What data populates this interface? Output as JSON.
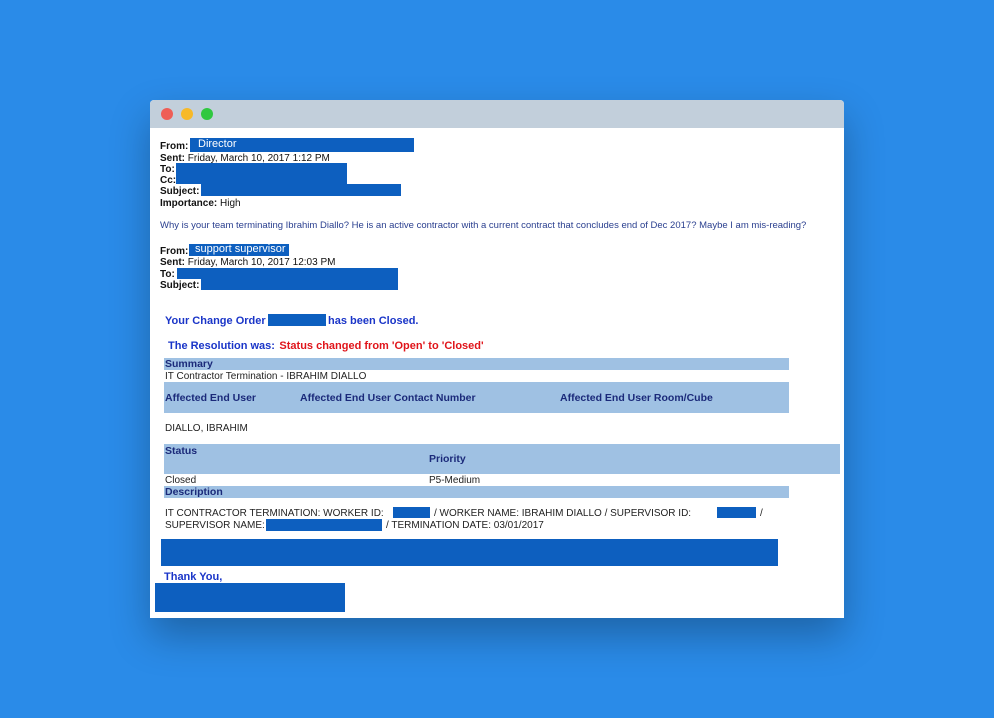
{
  "window": {
    "controls": [
      "close",
      "minimize",
      "zoom"
    ],
    "colors": {
      "close": "#ee5e56",
      "minimize": "#f7b928",
      "zoom": "#2fc840",
      "redaction": "#0d5fbf",
      "band": "#9fc1e3"
    }
  },
  "email1": {
    "from_label": "From:",
    "from_value": "Director",
    "sent_label": "Sent:",
    "sent_value": "Friday, March 10, 2017 1:12 PM",
    "to_label": "To:",
    "cc_label": "Cc:",
    "subject_label": "Subject:",
    "importance_label": "Importance:",
    "importance_value": "High",
    "body": "Why is your team terminating Ibrahim Diallo?  He is an active contractor with a current contract that concludes end of Dec 2017?  Maybe I am mis-reading?"
  },
  "email2": {
    "from_label": "From:",
    "from_value": "support supervisor",
    "sent_label": "Sent:",
    "sent_value": "Friday, March 10, 2017 12:03 PM",
    "to_label": "To:",
    "subject_label": "Subject:"
  },
  "notice": {
    "change_order_prefix": "Your Change Order",
    "change_order_suffix": "has been Closed.",
    "resolution_label": "The Resolution was:",
    "resolution_value": "Status changed from 'Open' to 'Closed'",
    "summary_header": "Summary",
    "summary_value": "IT Contractor Termination -  IBRAHIM  DIALLO",
    "affected_user_header": "Affected End User",
    "affected_contact_header": "Affected End User Contact Number",
    "affected_room_header": "Affected End User Room/Cube",
    "affected_user_value": "DIALLO, IBRAHIM",
    "status_header": "Status",
    "priority_header": "Priority",
    "status_value": "Closed",
    "priority_value": "P5-Medium",
    "description_header": "Description",
    "desc_worker_id": "IT CONTRACTOR TERMINATION:  WORKER ID:",
    "desc_worker_name": "/ WORKER NAME: IBRAHIM    DIALLO  / SUPERVISOR ID:",
    "desc_slash": "/",
    "desc_supervisor_name": "SUPERVISOR NAME:",
    "desc_termination": "/ TERMINATION DATE:  03/01/2017",
    "thank_you": "Thank You,"
  }
}
